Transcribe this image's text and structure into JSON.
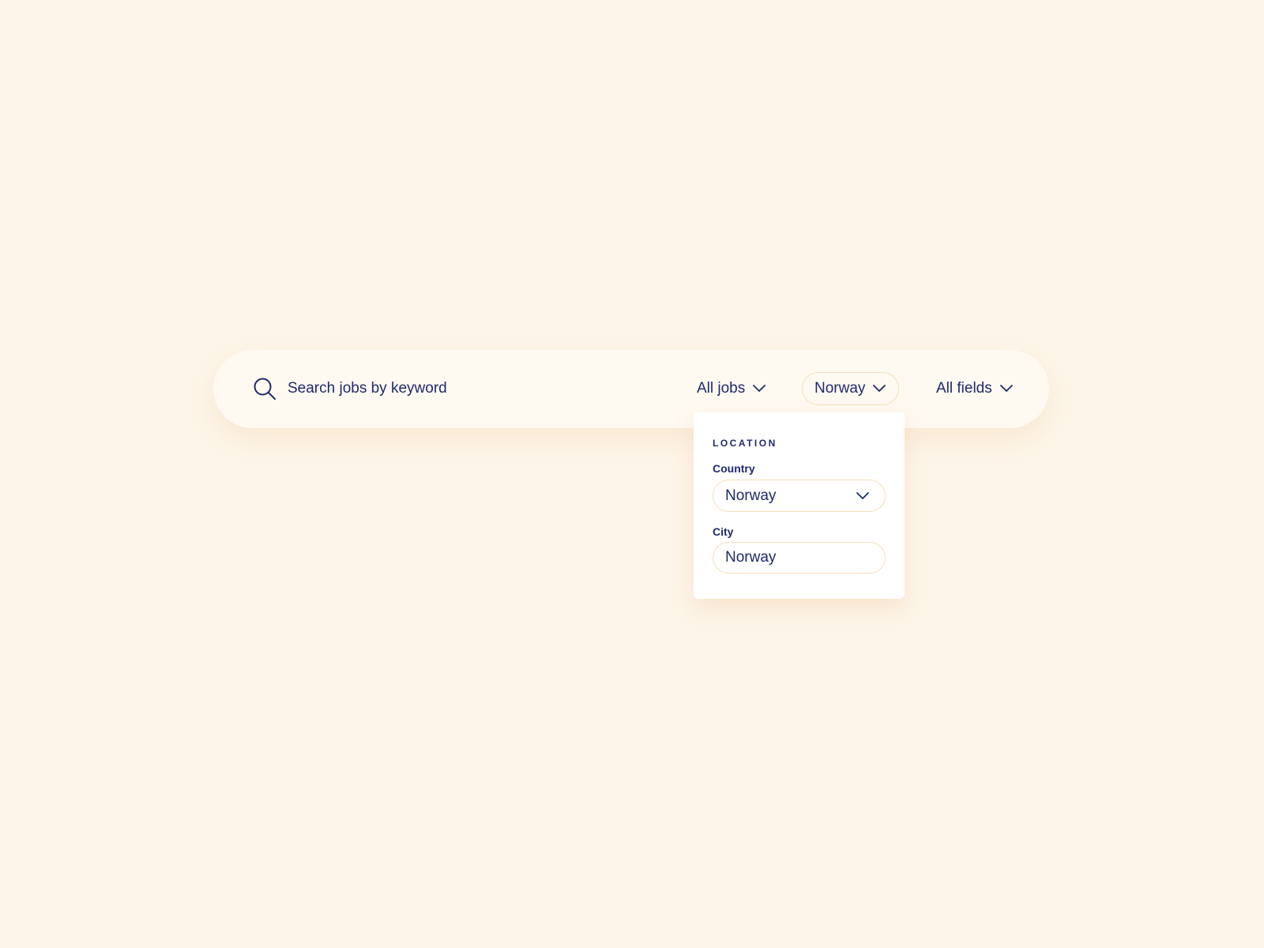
{
  "search": {
    "placeholder": "Search jobs by keyword",
    "icon": "search-icon"
  },
  "filters": {
    "jobs_label": "All jobs",
    "location_label": "Norway",
    "fields_label": "All fields"
  },
  "location_panel": {
    "title": "LOCATION",
    "country_label": "Country",
    "country_value": "Norway",
    "city_label": "City",
    "city_value": "Norway"
  },
  "colors": {
    "background": "#fdf5e8",
    "bar": "#fef9f1",
    "text": "#1e2a6e",
    "border": "#f6dfbc"
  }
}
